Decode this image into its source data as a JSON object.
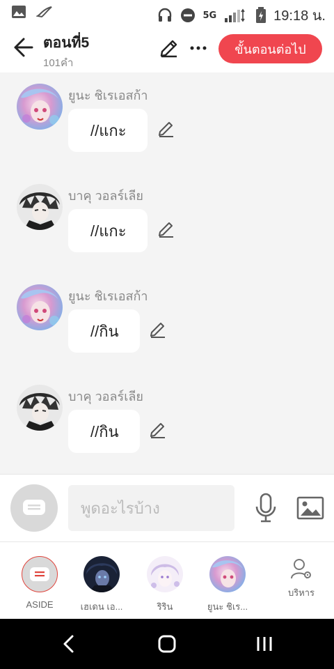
{
  "status_bar": {
    "time": "19:18 น.",
    "network": "5G",
    "icons": [
      "gallery-icon",
      "app-bird-icon",
      "headphones-icon",
      "do-not-disturb-icon",
      "signal-icon",
      "battery-icon"
    ]
  },
  "header": {
    "title": "ตอนที่5",
    "word_count": "101คำ",
    "next_button": "ขั้นตอนต่อไป",
    "accent_color": "#f0464f"
  },
  "messages": [
    {
      "name": "ยูนะ ชิเรเอสก้า",
      "text": "//แกะ",
      "avatar": "pink-hair"
    },
    {
      "name": "บาคุ วอลร์เลีย",
      "text": "//แกะ",
      "avatar": "dark-hair"
    },
    {
      "name": "ยูนะ ชิเรเอสก้า",
      "text": "//กิน",
      "avatar": "pink-hair"
    },
    {
      "name": "บาคุ วอลร์เลีย",
      "text": "//กิน",
      "avatar": "dark-hair"
    }
  ],
  "input": {
    "placeholder": "พูดอะไรบ้าง"
  },
  "characters": [
    {
      "name": "ASIDE"
    },
    {
      "name": "เฮเดน เอ..."
    },
    {
      "name": "ริริน"
    },
    {
      "name": "ยูนะ ชิเร..."
    }
  ],
  "manage_label": "บริหาร"
}
